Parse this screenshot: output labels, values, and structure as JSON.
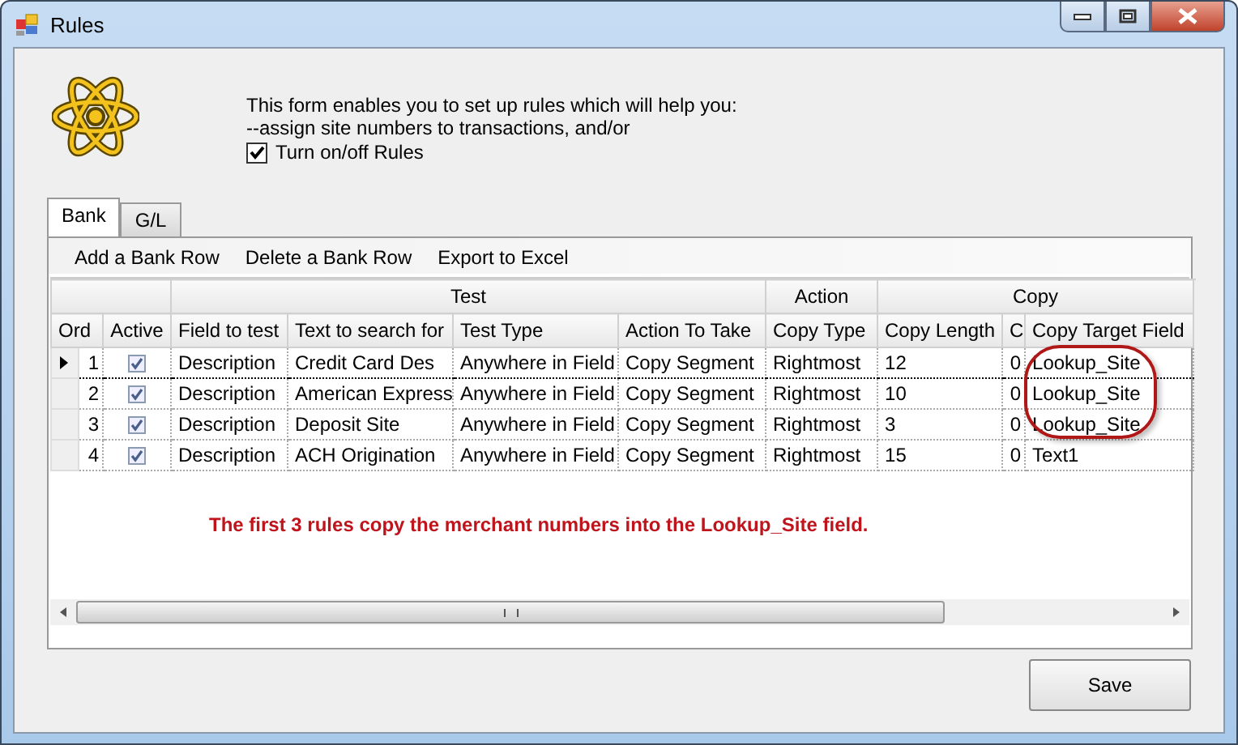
{
  "window": {
    "title": "Rules"
  },
  "intro": {
    "lines": [
      "This form enables you to set up rules which will help you:",
      "--assign site numbers to transactions, and/or"
    ]
  },
  "toggle": {
    "label": "Turn on/off Rules",
    "checked": true
  },
  "tabs": [
    {
      "label": "Bank",
      "selected": true
    },
    {
      "label": "G/L",
      "selected": false
    }
  ],
  "toolbar": [
    "Add a Bank Row",
    "Delete a Bank Row",
    "Export to Excel"
  ],
  "grid": {
    "groups": [
      "Test",
      "Action",
      "Copy"
    ],
    "columns": [
      "Ord",
      "Active",
      "Field to test",
      "Text to search for",
      "Test Type",
      "Action To Take",
      "Copy Type",
      "Copy Length",
      "C",
      "Copy Target Field"
    ],
    "rows": [
      {
        "selected": true,
        "active": true,
        "cells": [
          "1",
          "",
          "Description",
          "Credit Card Des",
          "Anywhere in Field",
          "Copy Segment",
          "Rightmost",
          "12",
          "0",
          "Lookup_Site"
        ]
      },
      {
        "selected": false,
        "active": true,
        "cells": [
          "2",
          "",
          "Description",
          "American Express",
          "Anywhere in Field",
          "Copy Segment",
          "Rightmost",
          "10",
          "0",
          "Lookup_Site"
        ]
      },
      {
        "selected": false,
        "active": true,
        "cells": [
          "3",
          "",
          "Description",
          "Deposit Site",
          "Anywhere in Field",
          "Copy Segment",
          "Rightmost",
          "3",
          "0",
          "Lookup_Site"
        ]
      },
      {
        "selected": false,
        "active": true,
        "cells": [
          "4",
          "",
          "Description",
          "ACH Origination",
          "Anywhere in Field",
          "Copy Segment",
          "Rightmost",
          "15",
          "0",
          "Text1"
        ]
      }
    ]
  },
  "annotation": "The first 3 rules copy the merchant numbers into the Lookup_Site field.",
  "save_button": "Save"
}
